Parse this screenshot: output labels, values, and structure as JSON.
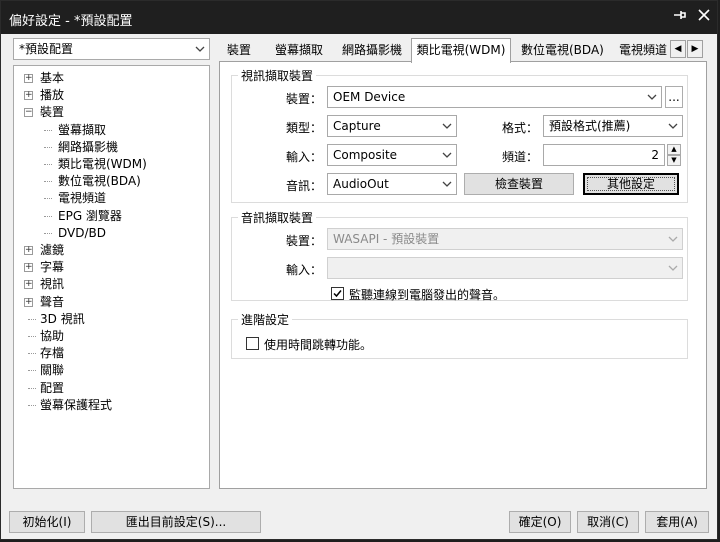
{
  "window": {
    "title": "偏好設定 - *預設配置"
  },
  "titlebar_icons": {
    "pin": "pin-icon",
    "close": "close-icon"
  },
  "profile": {
    "value": "*預設配置"
  },
  "tree": [
    {
      "label": "基本",
      "expander": "+"
    },
    {
      "label": "播放",
      "expander": "+"
    },
    {
      "label": "裝置",
      "expander": "−"
    },
    {
      "label": "螢幕擷取"
    },
    {
      "label": "網路攝影機"
    },
    {
      "label": "類比電視(WDM)"
    },
    {
      "label": "數位電視(BDA)"
    },
    {
      "label": "電視頻道"
    },
    {
      "label": "EPG 瀏覽器"
    },
    {
      "label": "DVD/BD"
    },
    {
      "label": "濾鏡",
      "expander": "+"
    },
    {
      "label": "字幕",
      "expander": "+"
    },
    {
      "label": "視訊",
      "expander": "+"
    },
    {
      "label": "聲音",
      "expander": "+"
    },
    {
      "label": "3D 視訊"
    },
    {
      "label": "協助"
    },
    {
      "label": "存檔"
    },
    {
      "label": "關聯"
    },
    {
      "label": "配置"
    },
    {
      "label": "螢幕保護程式"
    }
  ],
  "tabs": [
    "裝置",
    "螢幕擷取",
    "網路攝影機",
    "類比電視(WDM)",
    "數位電視(BDA)",
    "電視頻道"
  ],
  "video_group": {
    "title": "視訊擷取裝置",
    "device_label": "裝置：",
    "device_value": "OEM Device",
    "browse_label": "...",
    "type_label": "類型：",
    "type_value": "Capture",
    "format_label": "格式：",
    "format_value": "預設格式(推薦)",
    "input_label": "輸入：",
    "input_value": "Composite",
    "channel_label": "頻道：",
    "channel_value": "2",
    "audio_label": "音訊：",
    "audio_value": "AudioOut",
    "check_device": "檢查裝置",
    "other_settings": "其他設定"
  },
  "audio_group": {
    "title": "音訊擷取裝置",
    "device_label": "裝置：",
    "device_value": "WASAPI - 預設裝置",
    "input_label": "輸入：",
    "input_value": "",
    "monitor_label": "監聽連線到電腦發出的聲音。",
    "monitor_checked": true
  },
  "advanced_group": {
    "title": "進階設定",
    "timeshift_label": "使用時間跳轉功能。",
    "timeshift_checked": false
  },
  "footer": {
    "init": "初始化(I)",
    "export": "匯出目前設定(S)...",
    "ok": "確定(O)",
    "cancel": "取消(C)",
    "apply": "套用(A)"
  }
}
